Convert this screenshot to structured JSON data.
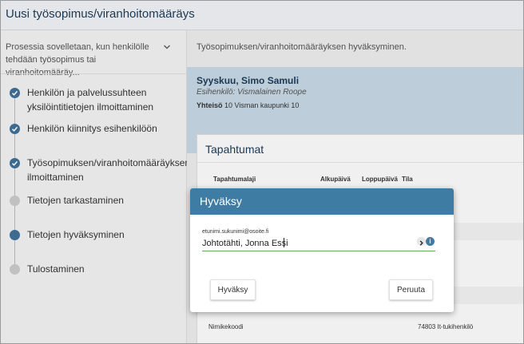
{
  "window": {
    "title": "Uusi työsopimus/viranhoitomääräys"
  },
  "sidebar": {
    "process_text": "Prosessia sovelletaan, kun henkilölle tehdään työsopimus tai viranhoitomääräy...",
    "steps": [
      {
        "label": "Henkilön ja palvelussuhteen yksilöintitietojen ilmoittaminen",
        "state": "done"
      },
      {
        "label": "Henkilön kiinnitys esihenkilöön",
        "state": "done"
      },
      {
        "label": "Työsopimuksen/viranhoitomääräyksen ilmoittaminen",
        "state": "done"
      },
      {
        "label": "Tietojen tarkastaminen",
        "state": "todo"
      },
      {
        "label": "Tietojen hyväksyminen",
        "state": "current"
      },
      {
        "label": "Tulostaminen",
        "state": "todo"
      }
    ]
  },
  "main": {
    "subtitle": "Työsopimuksen/viranhoitomääräyksen hyväksyminen.",
    "person": {
      "name": "Syyskuu, Simo Samuli",
      "supervisor": "Esihenkilö: Vismalainen Roope",
      "org_label": "Yhteisö",
      "org_value": "10 Visman kaupunki 10"
    },
    "events": {
      "title": "Tapahtumat",
      "columns": [
        "Tapahtumalaji",
        "Alkupäivä",
        "Loppupäivä",
        "Tila"
      ],
      "nimikekoodi_label": "Nimikekoodi",
      "nimikekoodi_value": "74803 It-tukihenkilö"
    }
  },
  "modal": {
    "title": "Hyväksy",
    "field_label": "etunimi.sukunimi@osoite.fi",
    "field_value": "Johtotähti, Jonna Essi",
    "info_glyph": "i",
    "approve_label": "Hyväksy",
    "cancel_label": "Peruuta"
  },
  "colors": {
    "header_bg": "#3f7ca4",
    "step_active": "#3f6f97",
    "step_inactive": "#c9c9c9",
    "field_underline": "#5cad5c",
    "person_panel": "#c5d6e2"
  }
}
